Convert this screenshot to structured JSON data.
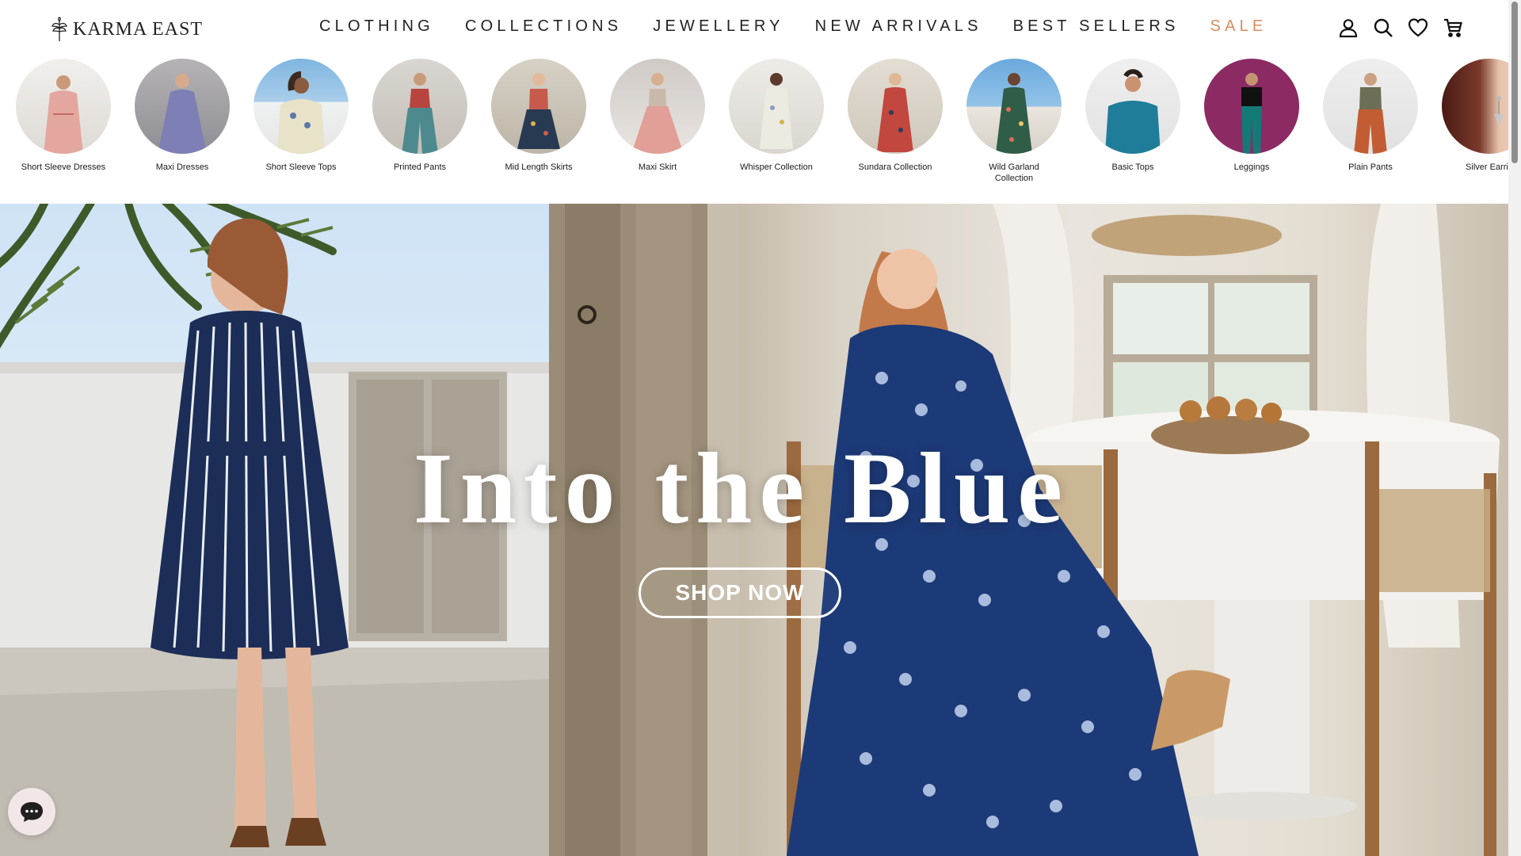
{
  "brand": {
    "name": "KARMA EAST"
  },
  "nav": {
    "items": [
      {
        "label": "CLOTHING"
      },
      {
        "label": "COLLECTIONS"
      },
      {
        "label": "JEWELLERY"
      },
      {
        "label": "NEW ARRIVALS"
      },
      {
        "label": "BEST SELLERS"
      },
      {
        "label": "SALE"
      }
    ],
    "sale_color": "#d98a5f"
  },
  "header_icons": [
    "account-icon",
    "search-icon",
    "heart-icon",
    "cart-icon"
  ],
  "categories": [
    {
      "label": "Short Sleeve Dresses"
    },
    {
      "label": "Maxi Dresses"
    },
    {
      "label": "Short Sleeve Tops"
    },
    {
      "label": "Printed Pants"
    },
    {
      "label": "Mid Length Skirts"
    },
    {
      "label": "Maxi Skirt"
    },
    {
      "label": "Whisper Collection"
    },
    {
      "label": "Sundara Collection"
    },
    {
      "label": "Wild Garland Collection"
    },
    {
      "label": "Basic Tops"
    },
    {
      "label": "Leggings"
    },
    {
      "label": "Plain Pants"
    },
    {
      "label": "Silver Earrin"
    }
  ],
  "hero": {
    "title": "Into the Blue",
    "cta_label": "SHOP NOW"
  },
  "chat": {
    "icon": "chat-bubble-icon"
  }
}
